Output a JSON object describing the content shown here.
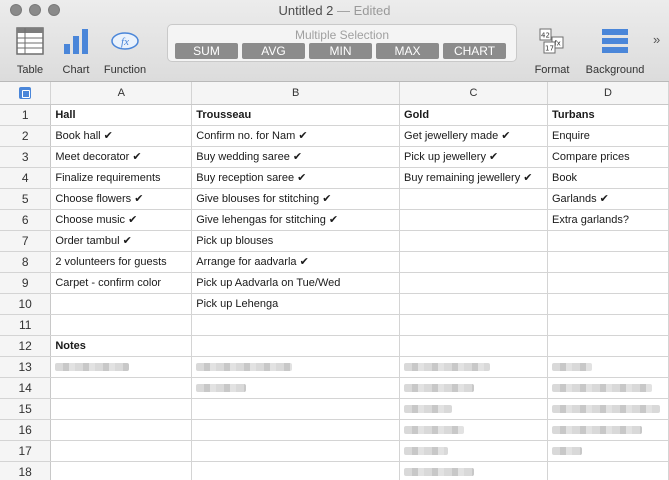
{
  "window": {
    "title": "Untitled 2",
    "edited": " — Edited"
  },
  "toolbar": {
    "table_label": "Table",
    "chart_label": "Chart",
    "function_label": "Function",
    "format_label": "Format",
    "background_label": "Background",
    "selection": {
      "caption": "Multiple Selection",
      "buttons": [
        "SUM",
        "AVG",
        "MIN",
        "MAX",
        "CHART"
      ]
    },
    "accent_color": "#4a86d9"
  },
  "sheet": {
    "columns": [
      "A",
      "B",
      "C",
      "D"
    ],
    "row_numbers": [
      "1",
      "2",
      "3",
      "4",
      "5",
      "6",
      "7",
      "8",
      "9",
      "10",
      "11",
      "12",
      "13",
      "14",
      "15",
      "16",
      "17",
      "18"
    ],
    "cells": {
      "A": [
        "Hall",
        "Book hall ✔",
        "Meet decorator ✔",
        "Finalize requirements",
        "Choose flowers ✔",
        "Choose music ✔",
        "Order tambul ✔",
        "2 volunteers for guests",
        "Carpet - confirm color",
        "",
        "",
        "Notes"
      ],
      "B": [
        "Trousseau",
        "Confirm no. for Nam ✔",
        "Buy wedding saree ✔",
        "Buy reception saree ✔",
        "Give blouses for stitching ✔",
        "Give lehengas for stitching ✔",
        "Pick up blouses",
        "Arrange for aadvarla ✔",
        "Pick up Aadvarla on Tue/Wed",
        "Pick up Lehenga",
        "",
        ""
      ],
      "C": [
        "Gold",
        "Get jewellery made ✔",
        "Pick up jewellery ✔",
        "Buy remaining jewellery ✔",
        "",
        "",
        "",
        "",
        "",
        "",
        "",
        ""
      ],
      "D": [
        "Turbans",
        "Enquire",
        "Compare prices",
        "Book",
        "Garlands ✔",
        "Extra garlands?",
        "",
        "",
        "",
        "",
        "",
        ""
      ]
    }
  }
}
